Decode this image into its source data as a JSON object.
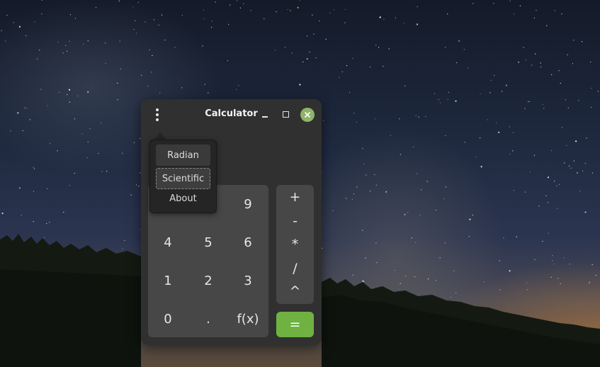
{
  "window": {
    "title": "Calculator"
  },
  "menu": {
    "items": [
      {
        "label": "Radian"
      },
      {
        "label": "Scientific"
      },
      {
        "label": "About"
      }
    ]
  },
  "keypad": {
    "keys": [
      "9",
      "4",
      "5",
      "6",
      "1",
      "2",
      "3",
      "0",
      ".",
      "f(x)"
    ]
  },
  "operators": {
    "keys": [
      "+",
      "-",
      "*",
      "/",
      "^"
    ],
    "equals": "="
  },
  "colors": {
    "window_bg": "#303030",
    "keypad_bg": "#474747",
    "equals_bg": "#6fb242",
    "close_button": "#8fb36a"
  },
  "icons": {
    "menu": "vertical-dots-icon",
    "minimize": "minimize-icon",
    "maximize": "maximize-icon",
    "close": "close-icon"
  }
}
